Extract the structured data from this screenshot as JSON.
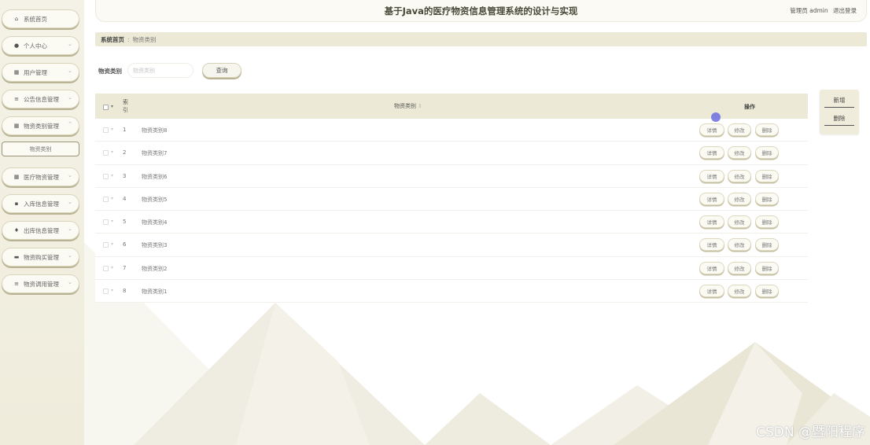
{
  "header": {
    "title": "基于Java的医疗物资信息管理系统的设计与实现",
    "user_role": "管理员 admin",
    "logout": "退出登录"
  },
  "sidebar": {
    "items": [
      {
        "label": "系统首页",
        "icon": "home-icon",
        "glyph": "⌂",
        "has_chevron": false
      },
      {
        "label": "个人中心",
        "icon": "user-icon",
        "glyph": "●",
        "has_chevron": true
      },
      {
        "label": "用户管理",
        "icon": "grid-icon",
        "glyph": "▦",
        "has_chevron": true
      },
      {
        "label": "公告信息管理",
        "icon": "list-icon",
        "glyph": "≡",
        "has_chevron": true
      },
      {
        "label": "物资类别管理",
        "icon": "grid-icon",
        "glyph": "▦",
        "has_chevron": true,
        "expanded": true
      },
      {
        "label": "医疗物资管理",
        "icon": "grid-icon",
        "glyph": "▦",
        "has_chevron": true
      },
      {
        "label": "入库信息管理",
        "icon": "box-icon",
        "glyph": "▪",
        "has_chevron": true
      },
      {
        "label": "出库信息管理",
        "icon": "pin-icon",
        "glyph": "♦",
        "has_chevron": true
      },
      {
        "label": "物资购买管理",
        "icon": "cart-icon",
        "glyph": "▬",
        "has_chevron": true
      },
      {
        "label": "物资调用管理",
        "icon": "list-icon",
        "glyph": "≡",
        "has_chevron": true
      }
    ],
    "submenu": {
      "label": "物资类别"
    }
  },
  "breadcrumb": {
    "home": "系统首页",
    "separator": ":",
    "current": "物资类别"
  },
  "search": {
    "label": "物资类别",
    "placeholder": "物资类别",
    "button": "查询"
  },
  "table": {
    "headers": {
      "index": "索引",
      "index_line1": "索",
      "index_line2": "引",
      "name": "物资类别",
      "operation": "操作"
    },
    "rows": [
      {
        "index": "1",
        "name": "物资类别8"
      },
      {
        "index": "2",
        "name": "物资类别7"
      },
      {
        "index": "3",
        "name": "物资类别6"
      },
      {
        "index": "4",
        "name": "物资类别5"
      },
      {
        "index": "5",
        "name": "物资类别4"
      },
      {
        "index": "6",
        "name": "物资类别3"
      },
      {
        "index": "7",
        "name": "物资类别2"
      },
      {
        "index": "8",
        "name": "物资类别1"
      }
    ],
    "row_actions": {
      "detail": "详情",
      "edit": "修改",
      "delete": "删除"
    }
  },
  "actions": {
    "add": "新增",
    "delete": "删除"
  },
  "watermark": "CSDN @暨阳程序",
  "colors": {
    "sidebar_bg": "#f4f2e6",
    "header_bar": "#ecead6",
    "accent_shadow": "#b9b394",
    "cursor": "#6c6ce0"
  }
}
